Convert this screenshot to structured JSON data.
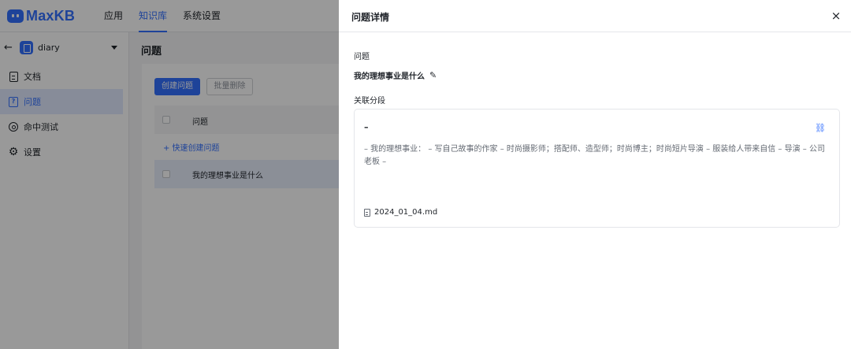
{
  "header": {
    "logo_text": "MaxKB",
    "nav": [
      {
        "label": "应用"
      },
      {
        "label": "知识库"
      },
      {
        "label": "系统设置"
      }
    ]
  },
  "sidebar": {
    "dataset_name": "diary",
    "items": [
      {
        "label": "文档",
        "icon": "document-icon"
      },
      {
        "label": "问题",
        "icon": "question-icon"
      },
      {
        "label": "命中测试",
        "icon": "target-icon"
      },
      {
        "label": "设置",
        "icon": "gear-icon"
      }
    ]
  },
  "main": {
    "title": "问题",
    "create_button": "创建问题",
    "batch_delete_button": "批量删除",
    "column_header": "问题",
    "quick_create": "+ 快速创建问题",
    "rows": [
      {
        "question": "我的理想事业是什么"
      }
    ]
  },
  "drawer": {
    "title": "问题详情",
    "close_icon": "×",
    "question_label": "问题",
    "question_value": "我的理想事业是什么",
    "edit_icon": "✎",
    "related_label": "关联分段",
    "paragraph": {
      "title": "–",
      "content": "– 我的理想事业： – 写自己故事的作家 – 时尚摄影师；搭配师、造型师；时尚博主；时尚短片导演 – 服装给人带来自信 – 导演 – 公司老板 –",
      "file_name": "2024_01_04.md",
      "link_icon": "⛓"
    }
  },
  "colors": {
    "accent": "#3370ff",
    "active_bg": "#e1eaff"
  }
}
